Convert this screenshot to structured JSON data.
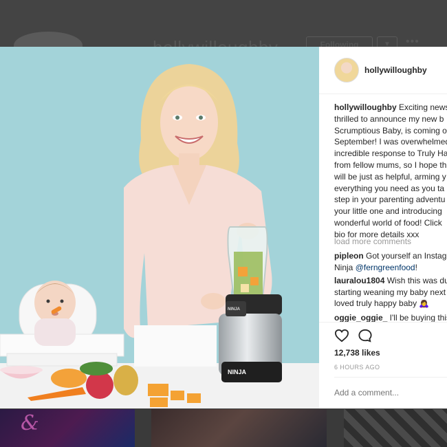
{
  "background": {
    "username": "hollywilloughby",
    "follow_label": "Following",
    "dropdown_symbol": "▼",
    "more_symbol": "•••"
  },
  "photo": {
    "brand_text": "NINJA",
    "panel_text": "NINJA"
  },
  "post": {
    "username": "hollywilloughby",
    "caption_username": "hollywilloughby",
    "caption_lines": [
      " Exciting news",
      "thrilled to announce my new b",
      "Scrumptious Baby, is coming o",
      "September! I was overwhelmed",
      "incredible response to Truly Ha",
      "from fellow mums, so I hope th",
      "will be just as helpful, arming y",
      "everything you need as you ta",
      "step in your parenting adventu",
      "your little one and introducing",
      "wonderful world of food! Click",
      "bio for more details xxx"
    ],
    "load_more": "load more comments",
    "comments": [
      {
        "user": "pipleon",
        "text_line1": " Got yourself an Instag",
        "text_line2": "Ninja ",
        "mention": "@ferngreenfood",
        "tail": "!"
      },
      {
        "user": "lauralou1804",
        "text_line1": " Wish this was du",
        "text_line2": "starting weaning my baby next",
        "text_line3": "loved truly happy baby 🙇‍♀️"
      },
      {
        "user": "oggie_oggie_",
        "text_line1": " I'll be buying this"
      }
    ],
    "likes": "12,738 likes",
    "time": "6 HOURS AGO",
    "add_comment_placeholder": "Add a comment..."
  }
}
